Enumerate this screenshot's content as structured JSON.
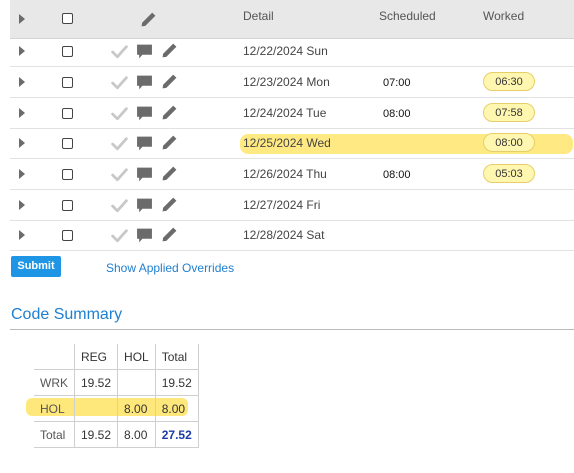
{
  "header": {
    "detail_label": "Detail",
    "scheduled_label": "Scheduled",
    "worked_label": "Worked"
  },
  "rows": [
    {
      "detail": "12/22/2024 Sun",
      "scheduled": "",
      "worked": "",
      "highlighted": false
    },
    {
      "detail": "12/23/2024 Mon",
      "scheduled": "07:00",
      "worked": "06:30",
      "highlighted": false
    },
    {
      "detail": "12/24/2024 Tue",
      "scheduled": "08:00",
      "worked": "07:58",
      "highlighted": false
    },
    {
      "detail": "12/25/2024 Wed",
      "scheduled": "",
      "worked": "08:00",
      "highlighted": true
    },
    {
      "detail": "12/26/2024 Thu",
      "scheduled": "08:00",
      "worked": "05:03",
      "highlighted": false
    },
    {
      "detail": "12/27/2024 Fri",
      "scheduled": "",
      "worked": "",
      "highlighted": false
    },
    {
      "detail": "12/28/2024 Sat",
      "scheduled": "",
      "worked": "",
      "highlighted": false
    }
  ],
  "actions": {
    "submit_label": "Submit",
    "overrides_link": "Show Applied Overrides"
  },
  "code_summary": {
    "title": "Code Summary",
    "columns": [
      "REG",
      "HOL",
      "Total"
    ],
    "rows": [
      {
        "label": "WRK",
        "cells": [
          "19.52",
          "",
          "19.52"
        ]
      },
      {
        "label": "HOL",
        "cells": [
          "",
          "8.00",
          "8.00"
        ]
      },
      {
        "label": "Total",
        "cells": [
          "19.52",
          "8.00",
          "27.52"
        ]
      }
    ]
  },
  "icons": [
    "expand-triangle-icon",
    "checkbox",
    "checkmark-icon",
    "comment-icon",
    "pencil-icon"
  ],
  "colors": {
    "accent": "#1f95e6",
    "link": "#1f7fd0",
    "highlight": "#ffe25a",
    "pill_bg": "#fff6b0",
    "grand_total": "#1e3aa8"
  }
}
